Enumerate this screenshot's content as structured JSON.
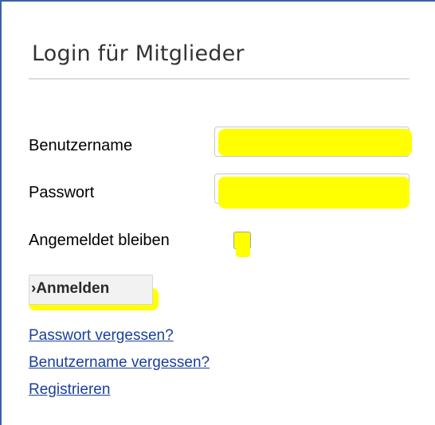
{
  "login": {
    "title": "Login für Mitglieder",
    "username_label": "Benutzername",
    "username_value": "",
    "password_label": "Passwort",
    "password_value": "",
    "remember_label": "Angemeldet bleiben",
    "remember_checked": false,
    "submit_chevron": "›",
    "submit_label": "Anmelden",
    "links": {
      "forgot_password": "Passwort vergessen?",
      "forgot_username": "Benutzername vergessen?",
      "register": "Registrieren"
    }
  },
  "colors": {
    "highlight": "#ffff00",
    "link": "#1a3f9c",
    "frame_border": "#3a63a8"
  }
}
